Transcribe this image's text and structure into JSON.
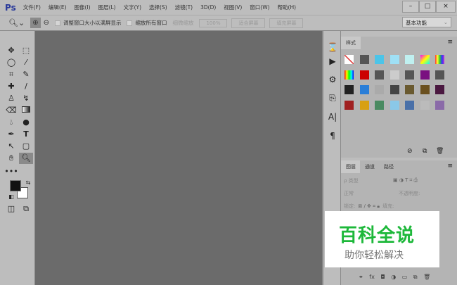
{
  "app": {
    "logo": "Ps"
  },
  "menu": [
    "文件(F)",
    "编辑(E)",
    "图像(I)",
    "图层(L)",
    "文字(Y)",
    "选择(S)",
    "滤镜(T)",
    "3D(D)",
    "视图(V)",
    "窗口(W)",
    "帮助(H)"
  ],
  "window": {
    "minimize": "–",
    "maximize": "□",
    "close": "×"
  },
  "options": {
    "resize_windows": "调整窗口大小以满屏显示",
    "zoom_all": "缩放所有窗口",
    "scrubby": "细微缩放",
    "btn_100": "100%",
    "fit_screen": "适合屏幕",
    "fill_screen": "填充屏幕",
    "workspace": "基本功能"
  },
  "styles_panel": {
    "tab": "样式",
    "swatches": [
      "none",
      "#555",
      "#4cc4e8",
      "#9fe0f5",
      "#bff0f0",
      "rainbow",
      "stripes",
      "spectrum",
      "#c00",
      "#555",
      "#ccc",
      "#555",
      "#7a1080",
      "#555",
      "#222",
      "#2a7ed8",
      "#aaa",
      "#444",
      "#6a5a30",
      "#6a5020",
      "#4a1840",
      "#a02020",
      "#d8a010",
      "#4a8a60",
      "#8ac8e8",
      "#4a70a8",
      "#bbb",
      "#8a6aa8"
    ]
  },
  "layers_panel": {
    "tabs": [
      "图层",
      "通道",
      "路径"
    ],
    "filter": "ρ 类型",
    "blend": "正常",
    "opacity": "不透明度:",
    "lock": "锁定:",
    "fill": "填充:"
  },
  "watermark": {
    "title": "百科全说",
    "subtitle": "助你轻松解决"
  },
  "colors": {
    "canvas": "#6b6b6b",
    "ui": "#bdbdbd",
    "watermark_green": "#1db83a"
  }
}
